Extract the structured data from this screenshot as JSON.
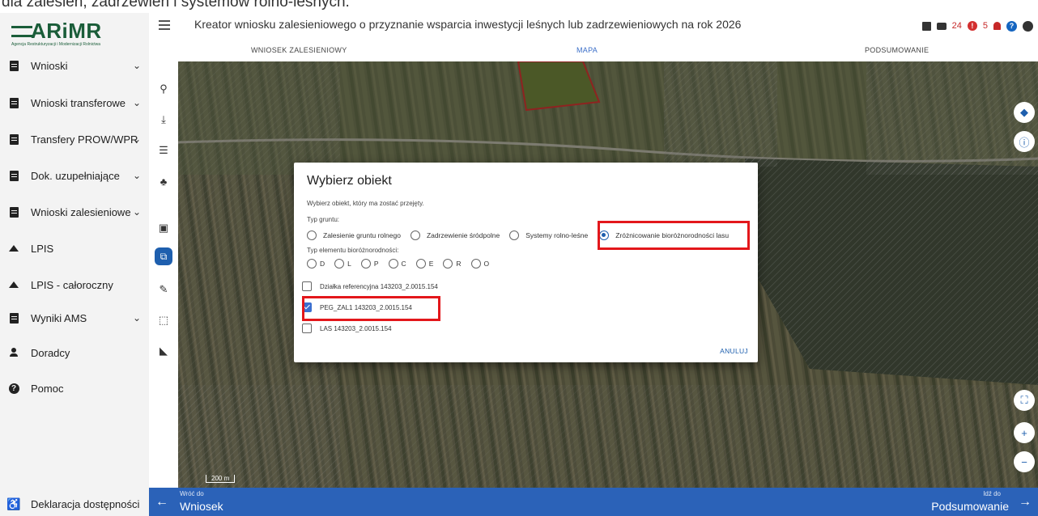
{
  "clipped_text": "dla zalesień, zadrzewień i systemów rolno-leśnych.",
  "logo": {
    "name": "ARiMR",
    "subtitle": "Agencja Restrukturyzacji i Modernizacji Rolnictwa"
  },
  "sidebar": {
    "items": [
      {
        "label": "Wnioski",
        "icon": "document-icon",
        "has_chevron": true
      },
      {
        "label": "Wnioski transferowe",
        "icon": "document-icon",
        "has_chevron": true
      },
      {
        "label": "Transfery PROW/WPR",
        "icon": "document-icon",
        "has_chevron": true
      },
      {
        "label": "Dok. uzupełniające",
        "icon": "document-icon",
        "has_chevron": true
      },
      {
        "label": "Wnioski zalesieniowe",
        "icon": "document-icon",
        "has_chevron": true
      },
      {
        "label": "LPIS",
        "icon": "mountain-icon",
        "has_chevron": false
      },
      {
        "label": "LPIS - całoroczny",
        "icon": "mountain-icon",
        "has_chevron": false
      },
      {
        "label": "Wyniki AMS",
        "icon": "document-icon",
        "has_chevron": true
      },
      {
        "label": "Doradcy",
        "icon": "person-icon",
        "has_chevron": false
      },
      {
        "label": "Pomoc",
        "icon": "help-icon",
        "has_chevron": false
      }
    ],
    "footer": "Deklaracja dostępności"
  },
  "header": {
    "title": "Kreator wniosku zalesieniowego o przyznanie wsparcia inwestycji leśnych lub zadrzewieniowych na rok 2026",
    "count_a": "24",
    "badge_a": "!",
    "count_b": "5",
    "help": "?"
  },
  "tabs": [
    "WNIOSEK ZALESIENIOWY",
    "MAPA",
    "PODSUMOWANIE"
  ],
  "active_tab": "MAPA",
  "map": {
    "scale": "200 m"
  },
  "dialog": {
    "title": "Wybierz obiekt",
    "subtitle": "Wybierz obiekt, który ma zostać przejęty.",
    "ground_type_label": "Typ gruntu:",
    "ground_types": [
      "Zalesienie gruntu rolnego",
      "Zadrzewienie śródpolne",
      "Systemy rolno-leśne",
      "Zróżnicowanie bioróżnorodności lasu"
    ],
    "selected_ground_type": "Zróżnicowanie bioróżnorodności lasu",
    "element_type_label": "Typ elementu bioróżnorodności:",
    "element_types": [
      "D",
      "L",
      "P",
      "C",
      "E",
      "R",
      "O"
    ],
    "checkboxes": [
      {
        "label": "Działka referencyjna 143203_2.0015.154",
        "checked": false
      },
      {
        "label": "PEG_ZAL1 143203_2.0015.154",
        "checked": true
      },
      {
        "label": "LAS 143203_2.0015.154",
        "checked": false
      }
    ],
    "cancel": "ANULUJ"
  },
  "bottom": {
    "left_small": "Wróć do",
    "left_big": "Wniosek",
    "right_small": "Idź do",
    "right_big": "Podsumowanie"
  },
  "colors": {
    "accent": "#2b62b8",
    "highlight": "#e3171b",
    "brand": "#1a5d39"
  }
}
